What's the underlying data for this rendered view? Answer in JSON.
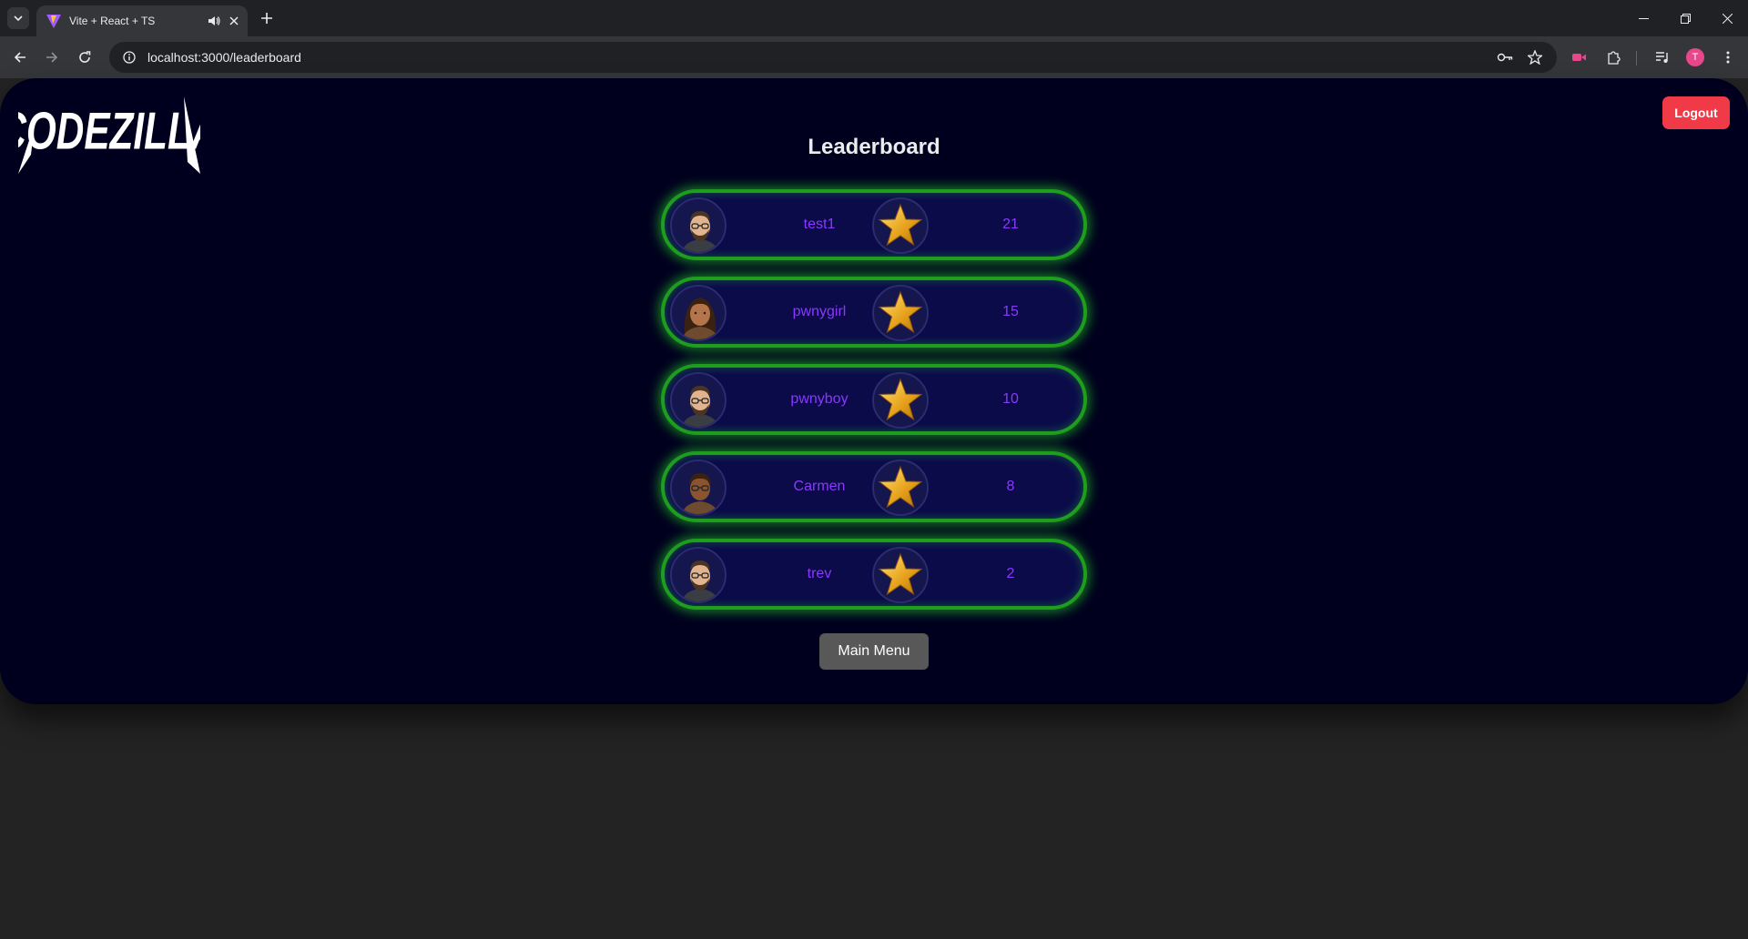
{
  "browser": {
    "tab_title": "Vite + React + TS",
    "url": "localhost:3000/leaderboard",
    "profile_initial": "T"
  },
  "app": {
    "logo_text": "CODEZILLA",
    "logout_label": "Logout",
    "title": "Leaderboard",
    "main_menu_label": "Main Menu"
  },
  "leaderboard": [
    {
      "name": "test1",
      "score": "21",
      "avatar": "man-beard-glasses-icon"
    },
    {
      "name": "pwnygirl",
      "score": "15",
      "avatar": "woman-long-hair-icon"
    },
    {
      "name": "pwnyboy",
      "score": "10",
      "avatar": "man-beard-glasses-icon"
    },
    {
      "name": "Carmen",
      "score": "8",
      "avatar": "woman-glasses-icon"
    },
    {
      "name": "trev",
      "score": "2",
      "avatar": "man-beard-glasses-icon"
    }
  ],
  "colors": {
    "app_bg": "#00001e",
    "row_bg": "#0b0b4a",
    "row_border": "#1f9d1f",
    "name_text": "#8a38ff",
    "logout_bg": "#f03a47",
    "main_menu_bg": "#585858"
  }
}
